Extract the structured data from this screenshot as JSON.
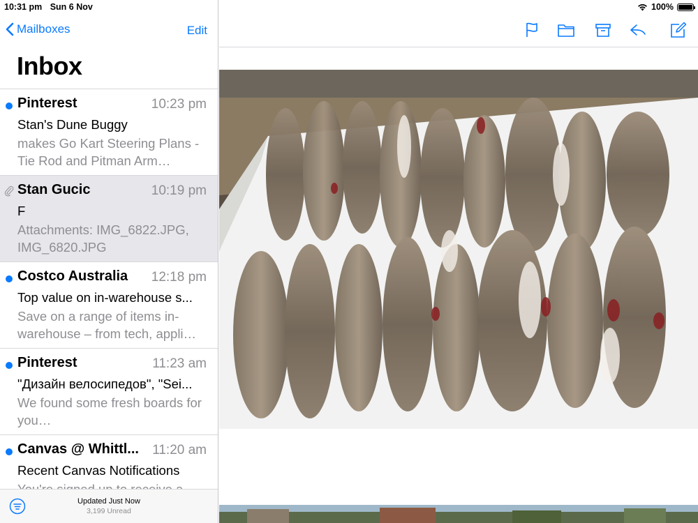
{
  "status_bar": {
    "time": "10:31 pm",
    "date": "Sun 6 Nov",
    "battery": "100%"
  },
  "nav": {
    "back_label": "Mailboxes",
    "edit_label": "Edit"
  },
  "title": "Inbox",
  "mails": [
    {
      "sender": "Pinterest",
      "time": "10:23 pm",
      "subject": "Stan's Dune Buggy",
      "preview": "makes Go Kart Steering Plans - Tie Rod and Pitman Arm…",
      "unread": true,
      "attachment": false,
      "selected": false
    },
    {
      "sender": "Stan Gucic",
      "time": "10:19 pm",
      "subject": "F",
      "preview": "Attachments: IMG_6822.JPG, IMG_6820.JPG",
      "unread": false,
      "attachment": true,
      "selected": true
    },
    {
      "sender": "Costco Australia",
      "time": "12:18 pm",
      "subject": "Top value on in-warehouse s...",
      "preview": "Save on a range of items in-warehouse – from tech, appli…",
      "unread": true,
      "attachment": false,
      "selected": false
    },
    {
      "sender": "Pinterest",
      "time": "11:23 am",
      "subject": "\"Дизайн велосипедов\", \"Sei...",
      "preview": "We found some fresh boards for you…",
      "unread": true,
      "attachment": false,
      "selected": false
    },
    {
      "sender": "Canvas @ Whittl...",
      "time": "11:20 am",
      "subject": "Recent Canvas Notifications",
      "preview": "You're signed up to receive a",
      "unread": true,
      "attachment": false,
      "selected": false
    }
  ],
  "footer": {
    "updated": "Updated Just Now",
    "unread": "3,199 Unread"
  },
  "toolbar_icons": [
    "flag-icon",
    "folder-icon",
    "archive-icon",
    "reply-icon",
    "compose-icon"
  ],
  "colors": {
    "accent": "#0a7aff",
    "secondary_text": "#8e8e93",
    "selected_row": "#e6e6eb"
  }
}
